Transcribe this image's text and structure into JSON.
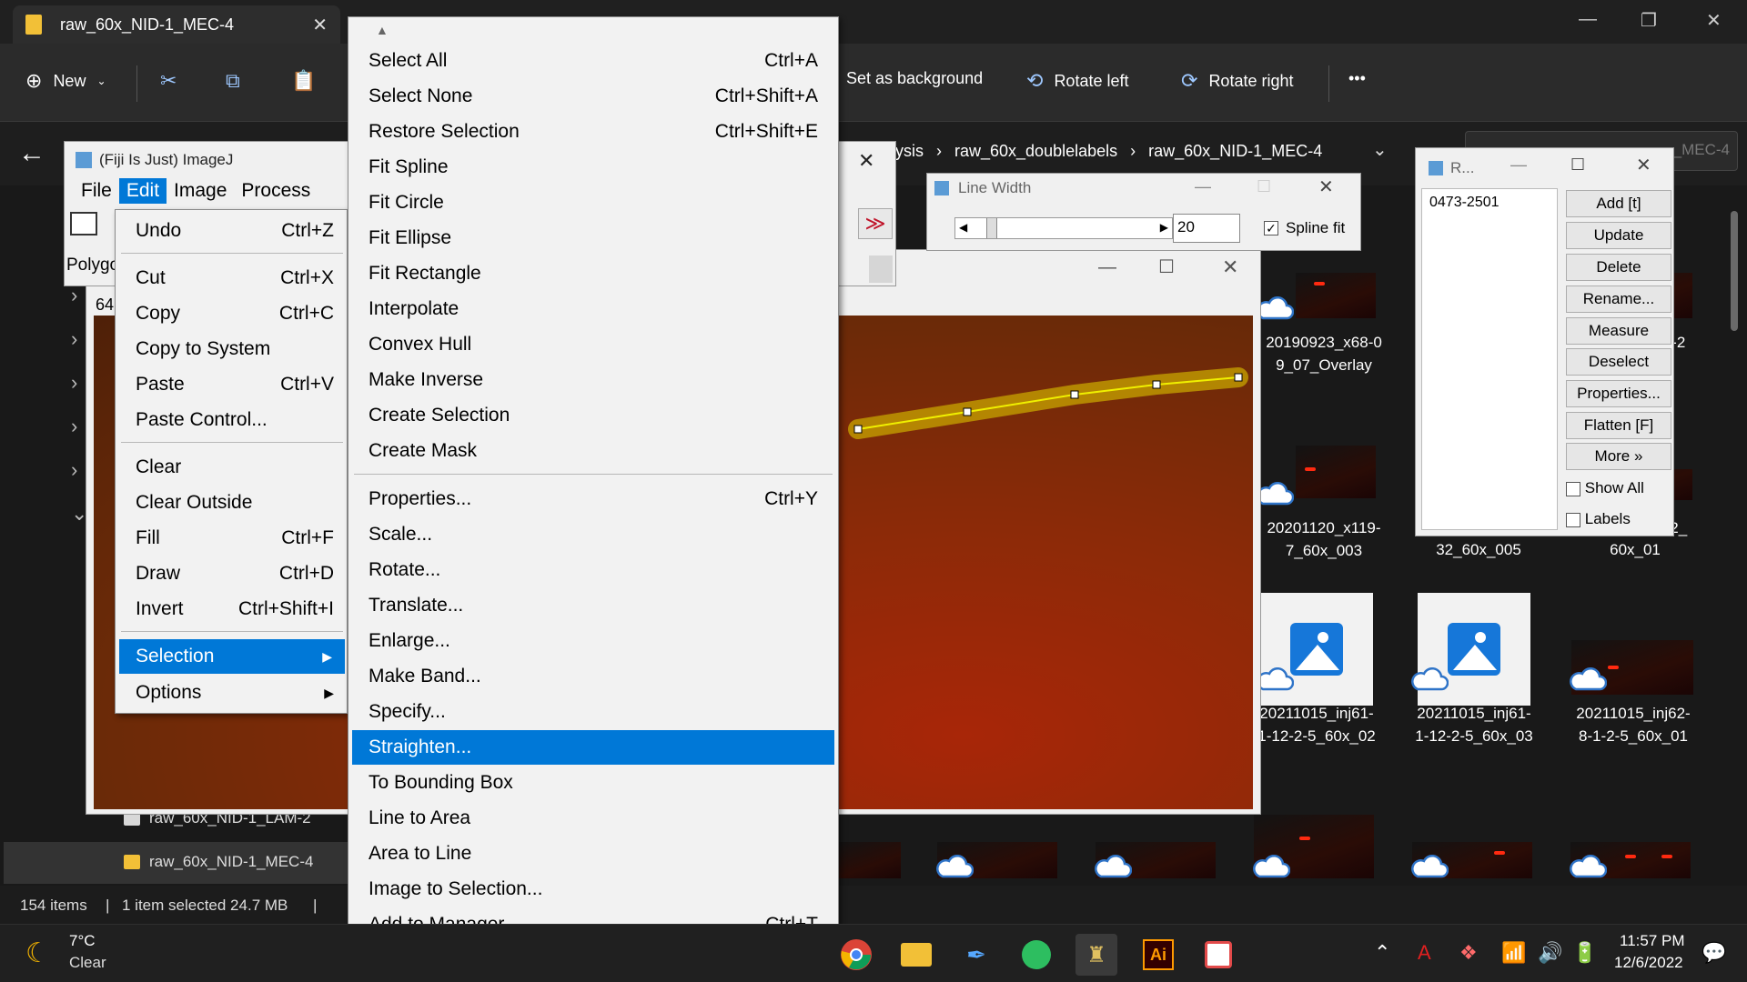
{
  "explorer": {
    "tab_title": "raw_60x_NID-1_MEC-4",
    "toolbar": {
      "new_label": "New",
      "set_background_label": "Set as background",
      "rotate_left_label": "Rotate left",
      "rotate_right_label": "Rotate right",
      "more_label": "•••"
    },
    "breadcrumbs": [
      "lysis",
      "raw_60x_doublelabels",
      "raw_60x_NID-1_MEC-4"
    ],
    "search_placeholder": "_MEC-4",
    "nav_items": [
      {
        "label": "raw_60x_NID-1_LAM-2"
      },
      {
        "label": "raw_60x_NID-1_MEC-4"
      }
    ],
    "files": [
      {
        "caption": "20190923_x68-0\n9_07_Overlay"
      },
      {
        "caption": "20201120_x119-\n7_60x_003"
      },
      {
        "caption": "32_60x_005"
      },
      {
        "caption": "60x_01"
      },
      {
        "caption": "20211015_inj61-\n1-12-2-5_60x_02"
      },
      {
        "caption": "20211015_inj61-\n1-12-2-5_60x_03"
      },
      {
        "caption": "20211015_inj62-\n8-1-2-5_60x_01"
      },
      {
        "caption": "3-2"
      },
      {
        "caption": "52_"
      }
    ],
    "status": {
      "count": "154 items",
      "selected": "1 item selected  24.7 MB"
    }
  },
  "imagej": {
    "title": "(Fiji Is Just) ImageJ",
    "menus": [
      "File",
      "Edit",
      "Image",
      "Process"
    ],
    "status_text": "Polygo",
    "image_win_label": "64"
  },
  "edit_menu": {
    "items": [
      {
        "label": "Undo",
        "shortcut": "Ctrl+Z"
      },
      {
        "label": "Cut",
        "shortcut": "Ctrl+X"
      },
      {
        "label": "Copy",
        "shortcut": "Ctrl+C"
      },
      {
        "label": "Copy to System",
        "shortcut": ""
      },
      {
        "label": "Paste",
        "shortcut": "Ctrl+V"
      },
      {
        "label": "Paste Control...",
        "shortcut": ""
      },
      {
        "label": "Clear",
        "shortcut": ""
      },
      {
        "label": "Clear Outside",
        "shortcut": ""
      },
      {
        "label": "Fill",
        "shortcut": "Ctrl+F"
      },
      {
        "label": "Draw",
        "shortcut": "Ctrl+D"
      },
      {
        "label": "Invert",
        "shortcut": "Ctrl+Shift+I"
      },
      {
        "label": "Selection",
        "shortcut": ""
      },
      {
        "label": "Options",
        "shortcut": ""
      }
    ]
  },
  "selection_menu": {
    "items": [
      {
        "label": "Select All",
        "shortcut": "Ctrl+A"
      },
      {
        "label": "Select None",
        "shortcut": "Ctrl+Shift+A"
      },
      {
        "label": "Restore Selection",
        "shortcut": "Ctrl+Shift+E"
      },
      {
        "label": "Fit Spline",
        "shortcut": ""
      },
      {
        "label": "Fit Circle",
        "shortcut": ""
      },
      {
        "label": "Fit Ellipse",
        "shortcut": ""
      },
      {
        "label": "Fit Rectangle",
        "shortcut": ""
      },
      {
        "label": "Interpolate",
        "shortcut": ""
      },
      {
        "label": "Convex Hull",
        "shortcut": ""
      },
      {
        "label": "Make Inverse",
        "shortcut": ""
      },
      {
        "label": "Create Selection",
        "shortcut": ""
      },
      {
        "label": "Create Mask",
        "shortcut": ""
      },
      {
        "label": "Properties...",
        "shortcut": "Ctrl+Y"
      },
      {
        "label": "Scale...",
        "shortcut": ""
      },
      {
        "label": "Rotate...",
        "shortcut": ""
      },
      {
        "label": "Translate...",
        "shortcut": ""
      },
      {
        "label": "Enlarge...",
        "shortcut": ""
      },
      {
        "label": "Make Band...",
        "shortcut": ""
      },
      {
        "label": "Specify...",
        "shortcut": ""
      },
      {
        "label": "Straighten...",
        "shortcut": ""
      },
      {
        "label": "To Bounding Box",
        "shortcut": ""
      },
      {
        "label": "Line to Area",
        "shortcut": ""
      },
      {
        "label": "Area to Line",
        "shortcut": ""
      },
      {
        "label": "Image to Selection...",
        "shortcut": ""
      },
      {
        "label": "Add to Manager",
        "shortcut": "Ctrl+T"
      }
    ]
  },
  "line_width": {
    "title": "Line Width",
    "value": "20",
    "spline_label": "Spline fit"
  },
  "roi_manager": {
    "title": "R...",
    "entry": "0473-2501",
    "buttons": [
      "Add [t]",
      "Update",
      "Delete",
      "Rename...",
      "Measure",
      "Deselect",
      "Properties...",
      "Flatten [F]",
      "More »"
    ],
    "show_all_label": "Show All",
    "labels_label": "Labels"
  },
  "taskbar": {
    "weather_temp": "7°C",
    "weather_desc": "Clear",
    "time": "11:57 PM",
    "date": "12/6/2022"
  },
  "colors": {
    "menu_highlight": "#0078d7",
    "roi_line": "#f0f000"
  }
}
